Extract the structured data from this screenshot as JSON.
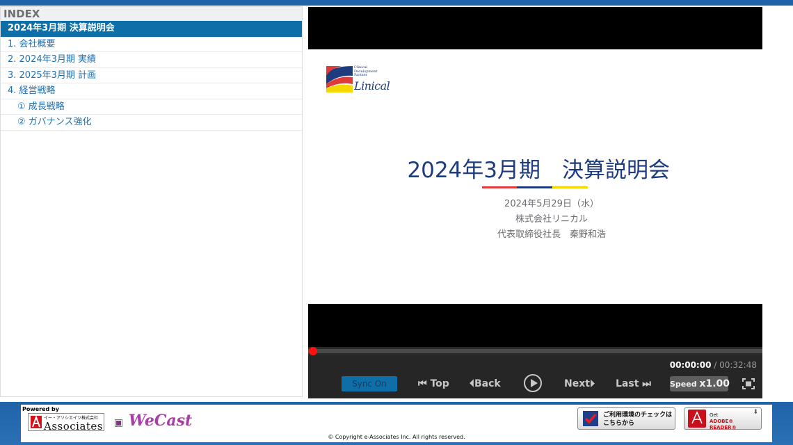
{
  "index": {
    "title": "INDEX",
    "items": [
      {
        "label": "2024年3月期 決算説明会"
      },
      {
        "label": "1. 会社概要"
      },
      {
        "label": "2. 2024年3月期 実績"
      },
      {
        "label": "3. 2025年3月期 計画"
      },
      {
        "label": "4. 経営戦略"
      },
      {
        "label": "① 成長戦略"
      },
      {
        "label": "② ガバナンス強化"
      }
    ]
  },
  "slide": {
    "logo_line1": "Clinical",
    "logo_line2": "Development",
    "logo_line3": "Partner",
    "logo_brand": "Linical",
    "title": "2024年3月期　決算説明会",
    "date": "2024年5月29日（水）",
    "company": "株式会社リニカル",
    "presenter": "代表取締役社長　秦野和浩",
    "accent_colors": [
      "#e03a3a",
      "#1d3b7d",
      "#f5d800"
    ]
  },
  "player": {
    "progress": 0,
    "time_current": "00:00:00",
    "time_separator": " / ",
    "time_total": "00:32:48",
    "sync_label": "Sync On",
    "top_label": "Top",
    "back_label": "Back",
    "next_label": "Next",
    "last_label": "Last",
    "speed_label": "Speed ",
    "speed_value": "x1.00"
  },
  "footer": {
    "powered_by": "Powered by",
    "assoc_kana": "イー・アソシエイツ株式会社",
    "assoc_name": "Associates",
    "wecast": "WeCast",
    "env_check_line1": "ご利用環境のチェックは",
    "env_check_line2": "こちらから",
    "adobe_get": "Get",
    "adobe_reader": "ADOBE® READER®",
    "copyright": "© Copyright e-Associates Inc. All rights reserved."
  }
}
